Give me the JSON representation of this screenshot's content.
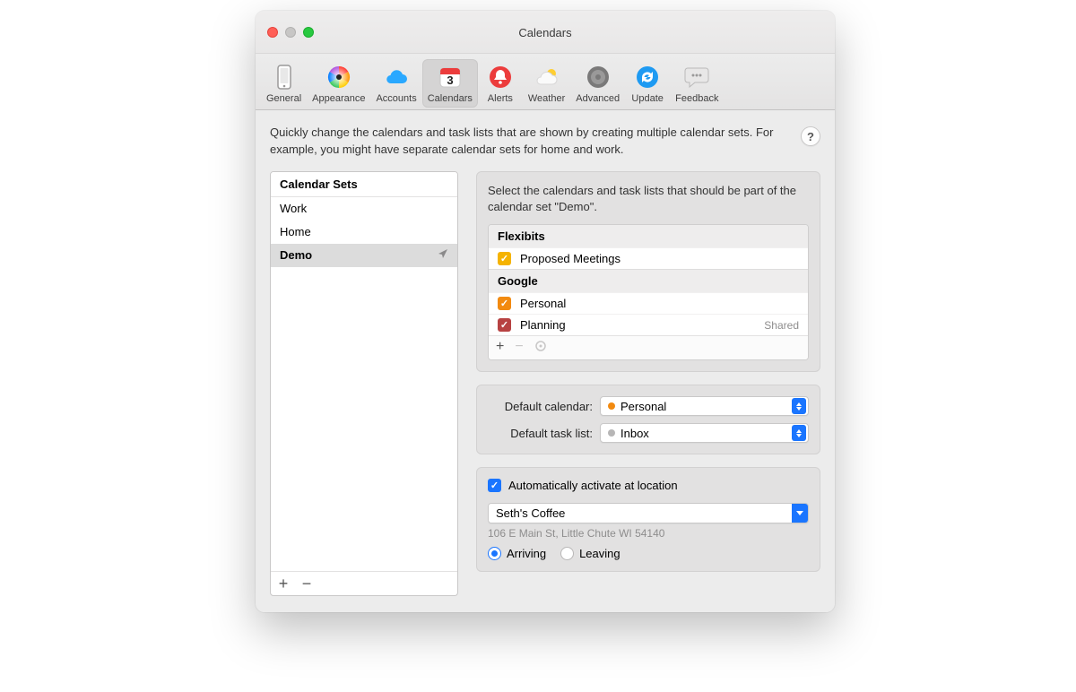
{
  "window": {
    "title": "Calendars"
  },
  "toolbar": {
    "items": [
      {
        "key": "general",
        "label": "General"
      },
      {
        "key": "appearance",
        "label": "Appearance"
      },
      {
        "key": "accounts",
        "label": "Accounts"
      },
      {
        "key": "calendars",
        "label": "Calendars",
        "selected": true
      },
      {
        "key": "alerts",
        "label": "Alerts"
      },
      {
        "key": "weather",
        "label": "Weather"
      },
      {
        "key": "advanced",
        "label": "Advanced"
      },
      {
        "key": "update",
        "label": "Update"
      },
      {
        "key": "feedback",
        "label": "Feedback"
      }
    ]
  },
  "intro": {
    "text": "Quickly change the calendars and task lists that are shown by creating multiple calendar sets. For example, you might have separate calendar sets for home and work.",
    "help": "?"
  },
  "sets": {
    "header": "Calendar Sets",
    "items": [
      {
        "name": "Work",
        "selected": false
      },
      {
        "name": "Home",
        "selected": false
      },
      {
        "name": "Demo",
        "selected": true,
        "location_indicator": true
      }
    ],
    "add": "+",
    "remove": "−"
  },
  "membership": {
    "description": "Select the calendars and task lists that should be part of the calendar set \"Demo\".",
    "groups": [
      {
        "name": "Flexibits",
        "calendars": [
          {
            "name": "Proposed Meetings",
            "checked": true,
            "color": "#f5b301"
          }
        ]
      },
      {
        "name": "Google",
        "calendars": [
          {
            "name": "Personal",
            "checked": true,
            "color": "#f28a10"
          },
          {
            "name": "Planning",
            "checked": true,
            "color": "#b74242",
            "badge": "Shared"
          }
        ]
      }
    ],
    "add": "+",
    "remove": "−",
    "gear": "⚙"
  },
  "defaults": {
    "calendar_label": "Default calendar:",
    "calendar_value": "Personal",
    "calendar_color": "#f28a10",
    "tasklist_label": "Default task list:",
    "tasklist_value": "Inbox",
    "tasklist_color": "#b7b6b6"
  },
  "location": {
    "checkbox_label": "Automatically activate at location",
    "checked": true,
    "place_value": "Seth's Coffee",
    "place_sub": "106 E Main St, Little Chute WI 54140",
    "arriving_label": "Arriving",
    "leaving_label": "Leaving",
    "mode": "arriving"
  }
}
